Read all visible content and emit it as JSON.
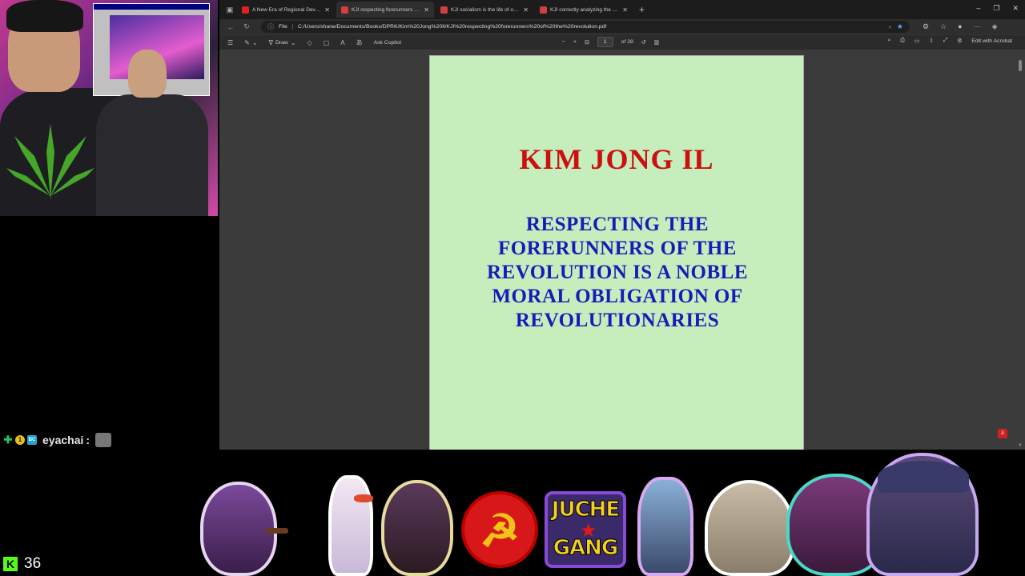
{
  "browser": {
    "tabs": [
      {
        "label": "A New Era of Regional Development",
        "favicon_color": "#e02020",
        "active": false
      },
      {
        "label": "KJI respecting forerunners of the revolution",
        "favicon_color": "#d04040",
        "active": true
      },
      {
        "label": "KJI socialism is the life of our people",
        "favicon_color": "#d04040",
        "active": false
      },
      {
        "label": "KJI correctly analyzing the precondition",
        "favicon_color": "#d04040",
        "active": false
      }
    ],
    "new_tab_glyph": "+",
    "window_controls": [
      "–",
      "❐",
      "✕"
    ],
    "address": {
      "scheme_label": "File",
      "url": "C:/Users/shane/Documents/Books/DPRK/Kim%20Jong%20Il/KJI%20respecting%20forerunners%20of%20the%20revolution.pdf"
    }
  },
  "pdf_toolbar": {
    "draw_label": "Draw",
    "ask_copilot_label": "Ask Copilot",
    "page_current": "1",
    "page_total": "of 28",
    "edit_label": "Edit with Acrobat"
  },
  "document": {
    "author": "KIM JONG IL",
    "title": "RESPECTING THE FORERUNNERS OF THE REVOLUTION IS A NOBLE MORAL OBLIGATION OF REVOLUTIONARIES",
    "page_bg": "#c6eebd",
    "author_color": "#cc1010",
    "title_color": "#1a1ab8"
  },
  "chat": {
    "username": "eyachai",
    "separator": ":",
    "badge_one": "1",
    "badge_bc": "BC"
  },
  "stream": {
    "viewer_count": "36",
    "platform_icon": "kick-icon",
    "kick_letter": "K"
  },
  "stickers": {
    "juche_top": "JUCHE",
    "juche_bottom": "GANG"
  }
}
